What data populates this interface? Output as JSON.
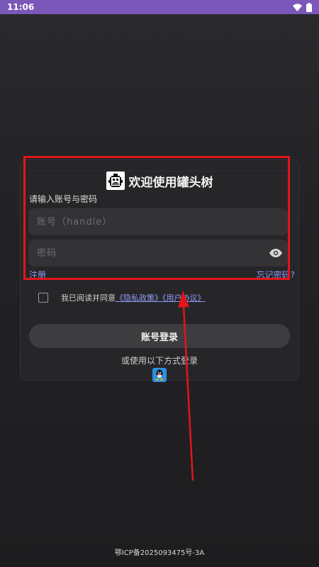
{
  "status_bar": {
    "time": "11:06",
    "wifi_icon": "wifi-icon",
    "battery_icon": "battery-icon"
  },
  "login": {
    "title": "欢迎使用罐头树",
    "hint": "请输入账号与密码",
    "account_placeholder": "账号（handle）",
    "password_placeholder": "密码",
    "register_label": "注册",
    "forgot_label": "忘记密码?",
    "agree_prefix": "我已阅读并同意",
    "privacy_link": "《隐私政策》",
    "terms_link": "《用户协议》",
    "login_button": "账号登录",
    "alt_login_text": "或使用以下方式登录"
  },
  "footer": {
    "icp": "鄂ICP备2025093475号-3A"
  },
  "colors": {
    "status_bar": "#7a57b8",
    "link": "#8f9cf5",
    "highlight": "#e0161b"
  }
}
